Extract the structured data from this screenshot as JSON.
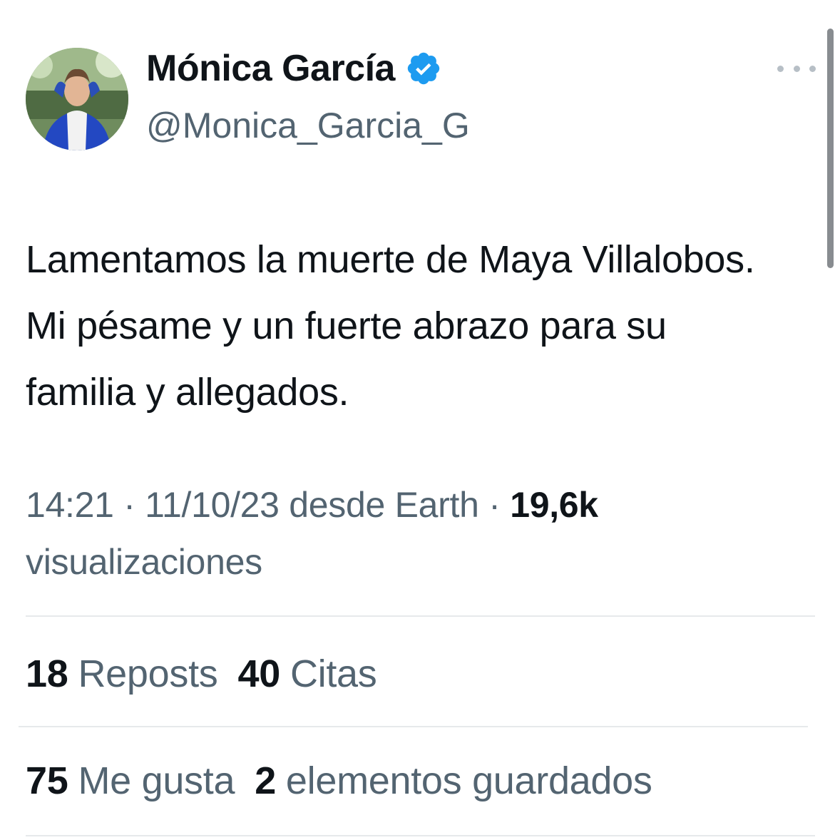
{
  "author": {
    "display_name": "Mónica García",
    "handle": "@Monica_Garcia_G",
    "verified_icon": "verified-badge-icon",
    "badge_color": "#1d9bf0"
  },
  "more_icon": "more-horizontal-icon",
  "tweet": {
    "text": "Lamentamos la muerte de Maya Villalobos. Mi pésame y un fuerte abrazo para su familia y allegados."
  },
  "meta": {
    "time": "14:21",
    "date": "11/10/23",
    "source": "desde Earth",
    "separator": "·",
    "views_count": "19,6k",
    "views_label": "visualizaciones"
  },
  "stats": {
    "reposts": {
      "value": "18",
      "label": "Reposts"
    },
    "quotes": {
      "value": "40",
      "label": "Citas"
    },
    "likes": {
      "value": "75",
      "label": "Me gusta"
    },
    "bookmarks": {
      "value": "2",
      "label": "elementos guardados"
    }
  },
  "colors": {
    "text_primary": "#0f1419",
    "text_secondary": "#536471",
    "divider": "#e6e9eb"
  }
}
